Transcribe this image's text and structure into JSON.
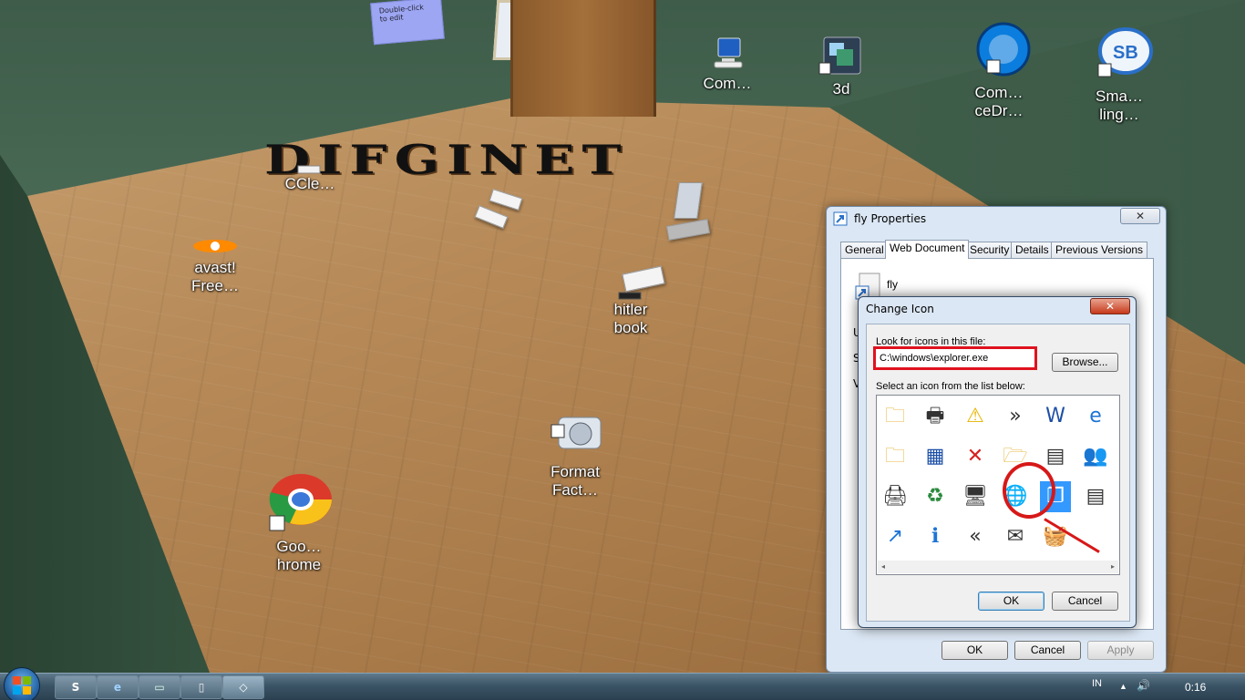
{
  "wallpaper": {
    "banner_text": "DIFGINET",
    "note_text": "Double-click\nto edit"
  },
  "desktop_icons": [
    {
      "label": "Com…",
      "icon": "computer-icon"
    },
    {
      "label": "3d",
      "icon": "3d-desktop-icon"
    },
    {
      "label": "Com…\nceDr…",
      "icon": "commandrive-icon"
    },
    {
      "label": "Sma…\nling…",
      "icon": "smartsb-icon"
    },
    {
      "label": "CCle…",
      "icon": "ccleaner-icon"
    },
    {
      "label": "avast!\nFree…",
      "icon": "avast-icon"
    },
    {
      "label": "hitler\nbook",
      "icon": "book-icon"
    },
    {
      "label": "Format\nFact…",
      "icon": "format-factory-icon"
    },
    {
      "label": "Goo…\nhrome",
      "icon": "google-chrome-icon"
    }
  ],
  "properties_window": {
    "title": "fly Properties",
    "close_label": "✕",
    "tabs": [
      "General",
      "Web Document",
      "Security",
      "Details",
      "Previous Versions"
    ],
    "active_tab": "Web Document",
    "file_name": "fly",
    "partial_labels": [
      "U",
      "S",
      "V"
    ],
    "buttons": {
      "ok": "OK",
      "cancel": "Cancel",
      "apply": "Apply"
    }
  },
  "change_icon_dialog": {
    "title": "Change Icon",
    "close_label": "✕",
    "look_for_label": "Look for icons in this file:",
    "path_value": "C:\\windows\\explorer.exe",
    "browse_label": "Browse...",
    "select_label": "Select an icon from the list below:",
    "icons": [
      {
        "name": "folder-icon",
        "glyph": "🗀"
      },
      {
        "name": "printer-help-icon",
        "glyph": "🖶"
      },
      {
        "name": "warning-icon",
        "glyph": "⚠"
      },
      {
        "name": "double-chevron-right-icon",
        "glyph": "»"
      },
      {
        "name": "document-icon",
        "glyph": "W"
      },
      {
        "name": "internet-explorer-icon",
        "glyph": "e"
      },
      {
        "name": "folder-up-icon",
        "glyph": "🗀"
      },
      {
        "name": "control-panel-icon",
        "glyph": "▦"
      },
      {
        "name": "error-icon",
        "glyph": "✕"
      },
      {
        "name": "folder-open-icon",
        "glyph": "🗁"
      },
      {
        "name": "server-document-icon",
        "glyph": "▤"
      },
      {
        "name": "users-icon",
        "glyph": "👥"
      },
      {
        "name": "printer-icon",
        "glyph": "🖨"
      },
      {
        "name": "recycle-bin-icon",
        "glyph": "♻"
      },
      {
        "name": "computer-icon",
        "glyph": "🖥"
      },
      {
        "name": "globe-icon",
        "glyph": "🌐"
      },
      {
        "name": "show-desktop-icon",
        "glyph": "❐",
        "selected": true
      },
      {
        "name": "document-list-icon",
        "glyph": "▤"
      },
      {
        "name": "arrow-document-icon",
        "glyph": "↗"
      },
      {
        "name": "info-icon",
        "glyph": "ℹ"
      },
      {
        "name": "double-chevron-left-icon",
        "glyph": "«"
      },
      {
        "name": "mail-icon",
        "glyph": "✉"
      },
      {
        "name": "basket-icon",
        "glyph": "🧺"
      }
    ],
    "scroll_left": "◂",
    "scroll_right": "▸",
    "buttons": {
      "ok": "OK",
      "cancel": "Cancel"
    }
  },
  "taskbar": {
    "apps": [
      {
        "name": "skype-icon",
        "glyph": "S"
      },
      {
        "name": "browser-icon",
        "glyph": "e"
      },
      {
        "name": "window-switcher-icon",
        "glyph": "▭"
      },
      {
        "name": "usb-drive-icon",
        "glyph": "▯"
      },
      {
        "name": "3d-desktop-icon",
        "glyph": "◇"
      }
    ],
    "language": "IN",
    "tray_flag": "▲",
    "volume_icon": "🔊",
    "clock": "0:16"
  },
  "colors": {
    "annotation_red": "#d71818",
    "selection_blue": "#3399ff"
  }
}
